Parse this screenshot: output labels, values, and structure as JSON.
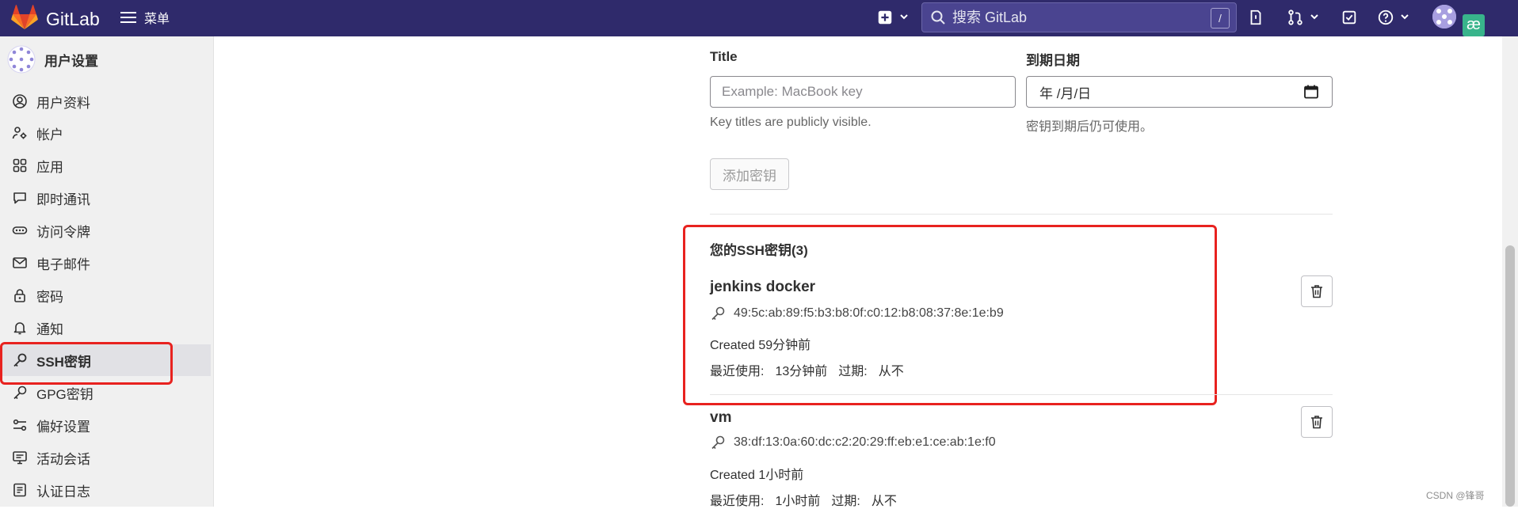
{
  "topbar": {
    "brand": "GitLab",
    "menu_label": "菜单",
    "search_placeholder": "搜索 GitLab",
    "search_shortcut": "/",
    "ext_badge": "æ"
  },
  "sidebar": {
    "title": "用户设置",
    "items": [
      {
        "label": "用户资料",
        "icon": "user-circle-icon"
      },
      {
        "label": "帐户",
        "icon": "account-gear-icon"
      },
      {
        "label": "应用",
        "icon": "apps-grid-icon"
      },
      {
        "label": "即时通讯",
        "icon": "chat-bubble-icon"
      },
      {
        "label": "访问令牌",
        "icon": "token-icon"
      },
      {
        "label": "电子邮件",
        "icon": "mail-icon"
      },
      {
        "label": "密码",
        "icon": "lock-icon"
      },
      {
        "label": "通知",
        "icon": "bell-icon"
      },
      {
        "label": "SSH密钥",
        "icon": "key-icon",
        "active": true
      },
      {
        "label": "GPG密钥",
        "icon": "key-icon"
      },
      {
        "label": "偏好设置",
        "icon": "preferences-icon"
      },
      {
        "label": "活动会话",
        "icon": "monitor-icon"
      },
      {
        "label": "认证日志",
        "icon": "log-icon"
      }
    ]
  },
  "form": {
    "title_label": "Title",
    "title_placeholder": "Example: MacBook key",
    "title_hint": "Key titles are publicly visible.",
    "expiry_label": "到期日期",
    "expiry_value": "年 /月/日",
    "expiry_hint": "密钥到期后仍可使用。",
    "add_button": "添加密钥"
  },
  "keys": {
    "section_title": "您的SSH密钥(3)",
    "items": [
      {
        "name": "jenkins docker",
        "fingerprint": "49:5c:ab:89:f5:b3:b8:0f:c0:12:b8:08:37:8e:1e:b9",
        "created": "Created 59分钟前",
        "last_used_label": "最近使用:",
        "last_used": "13分钟前",
        "expires_label": "过期:",
        "expires": "从不"
      },
      {
        "name": "vm",
        "fingerprint": "38:df:13:0a:60:dc:c2:20:29:ff:eb:e1:ce:ab:1e:f0",
        "created": "Created 1小时前",
        "last_used_label": "最近使用:",
        "last_used": "1小时前",
        "expires_label": "过期:",
        "expires": "从不"
      }
    ]
  },
  "colors": {
    "topbar": "#2f2a6b",
    "annotation": "#e8221f"
  },
  "watermark": "CSDN @锋哥"
}
